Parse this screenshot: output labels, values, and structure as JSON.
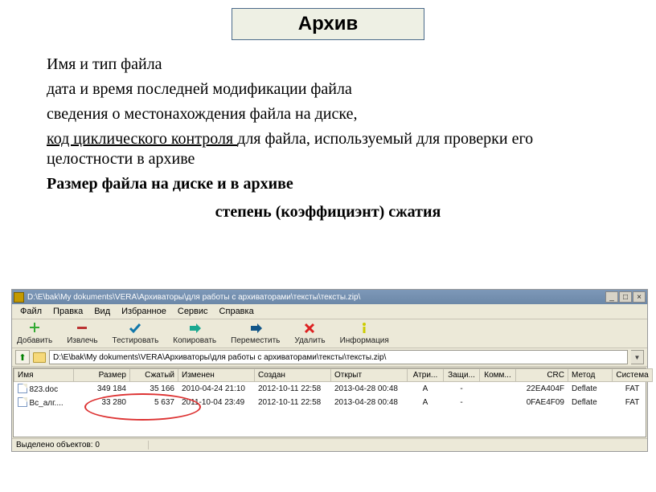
{
  "slide": {
    "title": "Архив",
    "lines": {
      "l1": "Имя и тип файла",
      "l2": "дата и время последней модификации файла",
      "l3": "сведения о местонахождения файла на диске,",
      "l4a": "код циклического контроля ",
      "l4b": "для файла, используемый для проверки его целостности в архиве",
      "l5": "Размер файла на диске и в архиве",
      "l6": "степень (коэффициэнт) сжатия"
    }
  },
  "window": {
    "title": "D:\\E\\bak\\My dokuments\\VERA\\Архиваторы\\для работы с архиваторами\\тексты\\тексты.zip\\",
    "path": "D:\\E\\bak\\My dokuments\\VERA\\Архиваторы\\для работы с архиваторами\\тексты\\тексты.zip\\",
    "menu": [
      "Файл",
      "Правка",
      "Вид",
      "Избранное",
      "Сервис",
      "Справка"
    ],
    "toolbar": [
      {
        "label": "Добавить",
        "icon": "plus"
      },
      {
        "label": "Извлечь",
        "icon": "minus"
      },
      {
        "label": "Тестировать",
        "icon": "check"
      },
      {
        "label": "Копировать",
        "icon": "right"
      },
      {
        "label": "Переместить",
        "icon": "move"
      },
      {
        "label": "Удалить",
        "icon": "x"
      },
      {
        "label": "Информация",
        "icon": "info"
      }
    ],
    "columns": [
      "Имя",
      "Размер",
      "Сжатый",
      "Изменен",
      "Создан",
      "Открыт",
      "Атри...",
      "Защи...",
      "Комм...",
      "CRC",
      "Метод",
      "Система"
    ],
    "rows": [
      {
        "name": "823.doc",
        "size": "349 184",
        "packed": "35 166",
        "modified": "2010-04-24 21:10",
        "created": "2012-10-11 22:58",
        "opened": "2013-04-28 00:48",
        "attr": "A",
        "prot": "-",
        "comm": "",
        "crc": "22EA404F",
        "method": "Deflate",
        "fs": "FAT"
      },
      {
        "name": "Вс_алг....",
        "size": "33 280",
        "packed": "5 637",
        "modified": "2011-10-04 23:49",
        "created": "2012-10-11 22:58",
        "opened": "2013-04-28 00:48",
        "attr": "A",
        "prot": "-",
        "comm": "",
        "crc": "0FAE4F09",
        "method": "Deflate",
        "fs": "FAT"
      }
    ],
    "status": "Выделено объектов: 0",
    "winbtns": {
      "min": "_",
      "max": "□",
      "close": "×"
    }
  }
}
